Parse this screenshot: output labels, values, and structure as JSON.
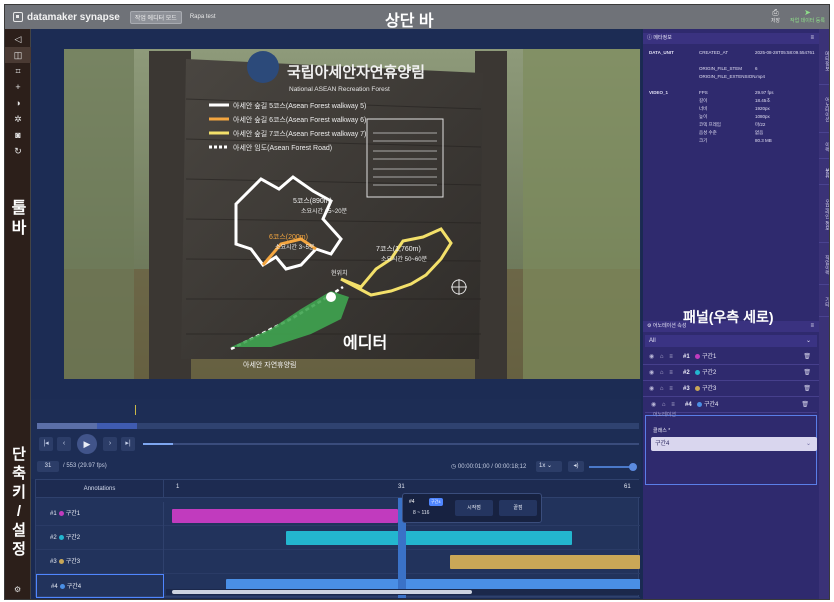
{
  "topbar": {
    "brand": "datamaker synapse",
    "mode_badge": "작업 에디터 모드",
    "project": "Rapa test",
    "annotation": "상단 바",
    "actions": [
      {
        "label": "저장"
      },
      {
        "label": "작업 데이터 등록"
      }
    ]
  },
  "toolbar": {
    "annotation_line1": "툴",
    "annotation_line2": "바",
    "annotation_bottom": [
      "단",
      "축",
      "키",
      "/",
      "설",
      "정"
    ],
    "tools": [
      {
        "icon": "cursor-icon"
      },
      {
        "icon": "panel-icon"
      },
      {
        "icon": "crop-icon"
      },
      {
        "icon": "plus-icon"
      },
      {
        "icon": "contrast-icon"
      },
      {
        "icon": "brightness-icon"
      },
      {
        "icon": "layer-icon"
      },
      {
        "icon": "rotate-icon"
      }
    ]
  },
  "editor": {
    "annotation": "에디터",
    "sign": {
      "title_kr": "국립아세안자연휴양림",
      "title_en": "National ASEAN Recreation Forest",
      "legend": [
        {
          "text": "아세안 숲길 5코스(Asean Forest walkway 5)",
          "color": "#ffffff"
        },
        {
          "text": "아세안 숲길 6코스(Asean Forest walkway 6)",
          "color": "#f4a640"
        },
        {
          "text": "아세안 숲길 7코스(Asean Forest walkway 7)",
          "color": "#f3e06a"
        },
        {
          "text": "아세안 임도(Asean Forest Road)",
          "color": "#ffffff"
        }
      ],
      "course5": "5코스(890m)",
      "course5_time": "소요시간 15~20분",
      "course6": "6코스(200m)",
      "course6_time": "소요시간 3~5분",
      "course7": "7코스(1,760m)",
      "course7_time": "소요시간 50~60분",
      "bridge": "현위치",
      "green_area": "아세안 자연휴양림"
    }
  },
  "playback": {
    "current_frame": "31",
    "total_frames": "/ 553 (29.97 fps)",
    "time": "00:00:01;00 / 00:00:18;12",
    "speed": "1x",
    "volume_level": 1.0
  },
  "timeline": {
    "column_title": "Annotations",
    "ticks": [
      "1",
      "31",
      "61"
    ],
    "rows": [
      {
        "id": "#1",
        "name": "구간1",
        "color": "#c13bbe",
        "start": 1,
        "end": 31
      },
      {
        "id": "#2",
        "name": "구간2",
        "color": "#23b6cf",
        "start": 16,
        "end": 51
      },
      {
        "id": "#3",
        "name": "구간3",
        "color": "#c9a757",
        "start": 38,
        "end": 61
      },
      {
        "id": "#4",
        "name": "구간4",
        "color": "#4a8fe6",
        "start": 8,
        "end": 61
      }
    ],
    "popup": {
      "id": "#4",
      "badge": "구간4",
      "range": "8 ~ 116",
      "start_btn": "시작점",
      "end_btn": "끝점"
    }
  },
  "right_panel": {
    "annotation": "패널(우측 세로)",
    "meta_title": "메타정보",
    "meta": [
      {
        "group": "DATA_UNIT",
        "key": "CREATED_AT",
        "value": "2025-08-28T05:58:09.554761"
      },
      {
        "group": "",
        "key": "ORIGIN_FILE_STEM",
        "value": "6"
      },
      {
        "group": "",
        "key": "ORIGIN_FILE_EXTENSION",
        "value": ".mp4"
      },
      {
        "group": "VIDEO_1",
        "key": "FPS",
        "value": "29.97 fps"
      },
      {
        "group": "",
        "key": "길이",
        "value": "18.45초"
      },
      {
        "group": "",
        "key": "너비",
        "value": "1920px"
      },
      {
        "group": "",
        "key": "높이",
        "value": "1080px"
      },
      {
        "group": "",
        "key": "코덱 프레임",
        "value": "마/22"
      },
      {
        "group": "",
        "key": "음성 수준",
        "value": "없음"
      },
      {
        "group": "",
        "key": "크기",
        "value": "80.3 MB"
      }
    ],
    "ann_title": "어노테이션 속성",
    "filter": "All",
    "items": [
      {
        "id": "#1",
        "name": "구간1",
        "color": "#c13bbe"
      },
      {
        "id": "#2",
        "name": "구간2",
        "color": "#23b6cf"
      },
      {
        "id": "#3",
        "name": "구간3",
        "color": "#c9a757"
      },
      {
        "id": "#4",
        "name": "구간4",
        "color": "#4a8fe6"
      }
    ],
    "selected_sub": "어노테이션",
    "class_label": "클래스 *",
    "class_value": "구간4",
    "vtabs": [
      "메타정보",
      "어노테이션",
      "이력",
      "분류",
      "오프라인 정보",
      "작업이력",
      "기타"
    ]
  }
}
